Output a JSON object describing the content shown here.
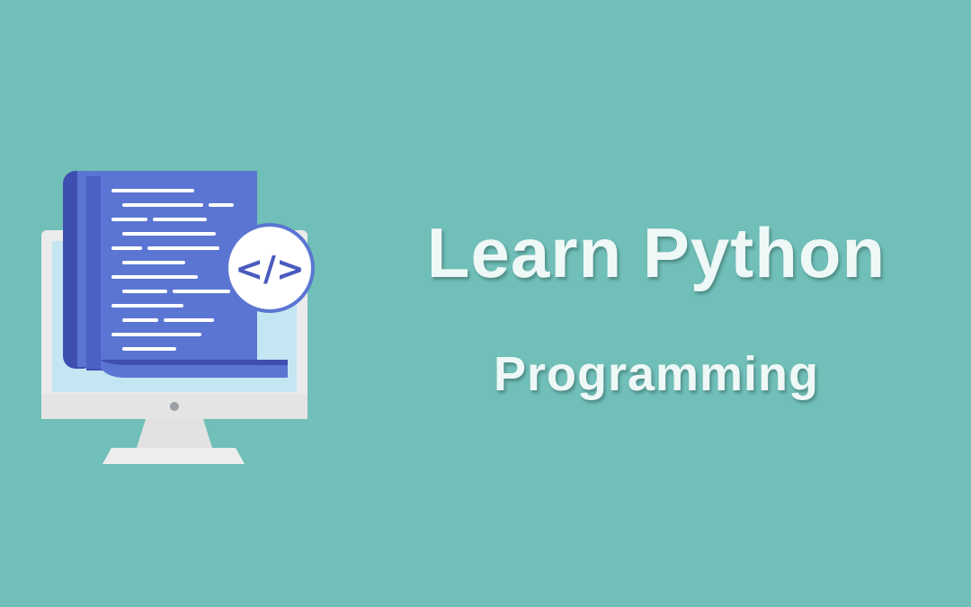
{
  "banner": {
    "title": "Learn Python",
    "subtitle": "Programming",
    "code_badge": "</>"
  },
  "colors": {
    "background": "#70bfb8",
    "title_text": "#eef8f6",
    "document": "#5b76d2",
    "document_fold": "#3f4fb0",
    "monitor_frame": "#eaeaea",
    "monitor_screen": "#c4e6f2",
    "badge_text": "#4a5bbd"
  },
  "icons": [
    "monitor-icon",
    "code-document-icon",
    "code-tag-icon"
  ]
}
